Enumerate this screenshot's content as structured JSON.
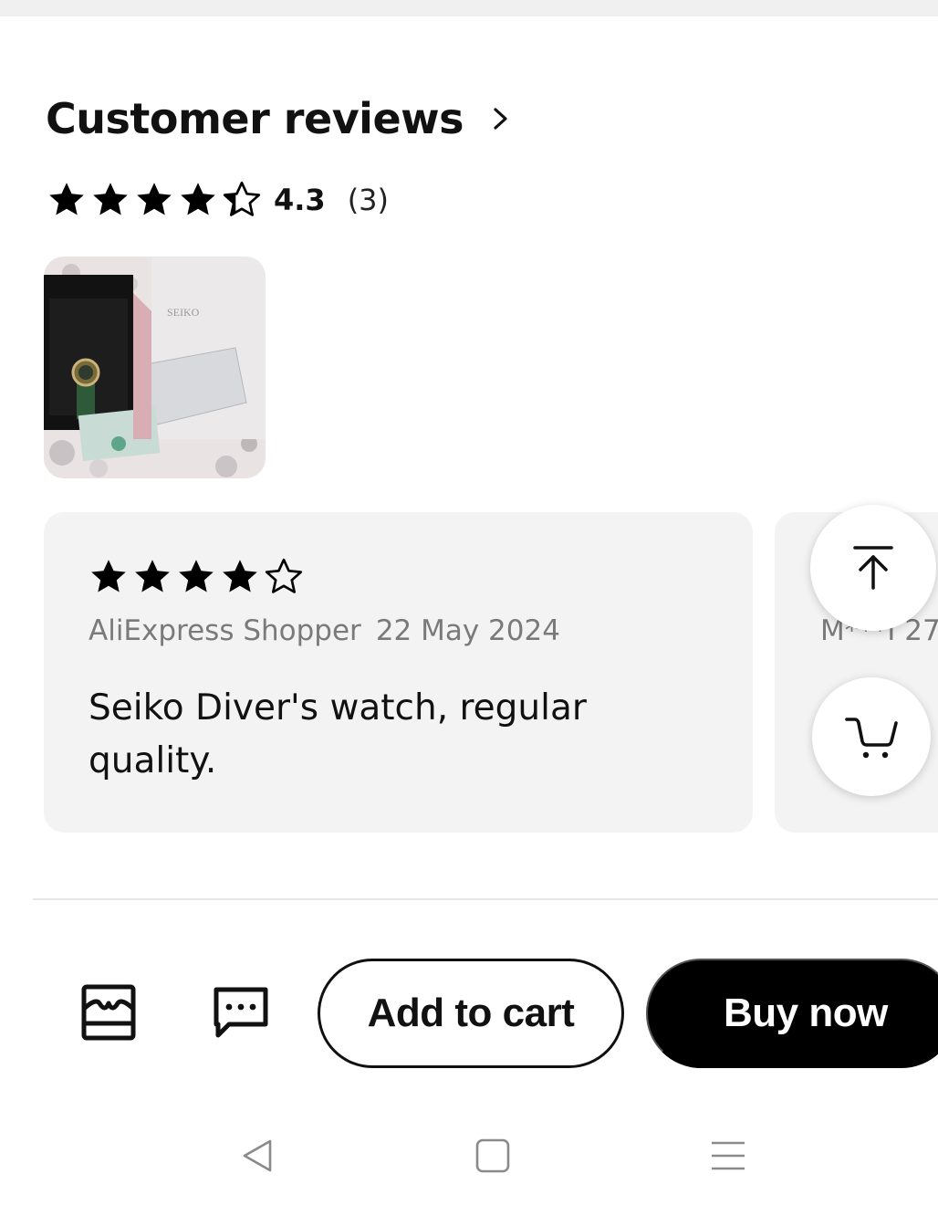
{
  "reviews_section": {
    "title": "Customer reviews",
    "average_rating": "4.3",
    "rating_value": 4.3,
    "review_count": "(3)",
    "chevron_icon": "chevron-right-icon"
  },
  "photo_thumbnail": {
    "brand_text": "SEIKO"
  },
  "reviews": [
    {
      "rating": 4,
      "author": "AliExpress Shopper",
      "date": "22 May 2024",
      "text": "Seiko Diver's watch, regular quality."
    },
    {
      "author_partial": "M***I 27"
    }
  ],
  "floating_buttons": {
    "scroll_top_icon": "arrow-up-to-top-icon",
    "cart_icon": "cart-icon"
  },
  "action_bar": {
    "store_icon": "store-icon",
    "chat_icon": "chat-icon",
    "add_to_cart_label": "Add to cart",
    "buy_now_label": "Buy now"
  },
  "system_nav": {
    "back_icon": "back-triangle-icon",
    "home_icon": "home-square-icon",
    "menu_icon": "menu-lines-icon"
  },
  "colors": {
    "card_background": "#f3f3f3",
    "primary_button": "#000000",
    "secondary_text": "#7a7a7a"
  }
}
